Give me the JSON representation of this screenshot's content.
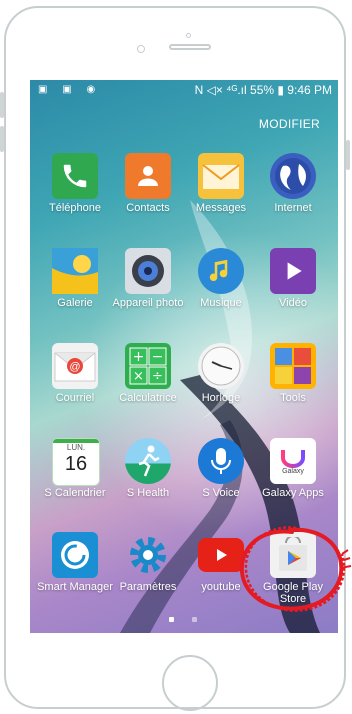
{
  "status_bar": {
    "left_icons": "▣ ▣ ◉",
    "right": "N ◁× ⁴ᴳ.ıl 55% ▮ 9:46 PM"
  },
  "top_action": "MODIFIER",
  "apps": [
    {
      "label": "Téléphone",
      "icon": "phone-icon",
      "color": "#2fa84f"
    },
    {
      "label": "Contacts",
      "icon": "contacts-icon",
      "color": "#f07a2c"
    },
    {
      "label": "Messages",
      "icon": "messages-icon",
      "color": "#f7c23b"
    },
    {
      "label": "Internet",
      "icon": "globe-icon",
      "color": "#3b5fc1"
    },
    {
      "label": "Galerie",
      "icon": "gallery-icon",
      "color": "#3aa0d8"
    },
    {
      "label": "Appareil photo",
      "icon": "camera-icon",
      "color": "#d9dde4"
    },
    {
      "label": "Musique",
      "icon": "music-icon",
      "color": "#2a8ad8"
    },
    {
      "label": "Vidéo",
      "icon": "video-icon",
      "color": "#7a3fb0"
    },
    {
      "label": "Courriel",
      "icon": "email-icon",
      "color": "#f2f2f2"
    },
    {
      "label": "Calculatrice",
      "icon": "calculator-icon",
      "color": "#2fae4f"
    },
    {
      "label": "Horloge",
      "icon": "clock-icon",
      "color": "#f3f3f3"
    },
    {
      "label": "Tools",
      "icon": "tools-folder-icon",
      "color": "#ffb300"
    },
    {
      "label": "S Calendrier",
      "icon": "calendar-icon",
      "color": "#ffffff",
      "day": "LUN.",
      "date": "16"
    },
    {
      "label": "S Health",
      "icon": "health-icon",
      "color": "#1fa66a"
    },
    {
      "label": "S Voice",
      "icon": "voice-icon",
      "color": "#1c7ad6"
    },
    {
      "label": "Galaxy Apps",
      "icon": "galaxy-apps-icon",
      "color": "#ffffff",
      "sub": "Galaxy"
    },
    {
      "label": "Smart Manager",
      "icon": "smart-manager-icon",
      "color": "#1b8fd4"
    },
    {
      "label": "Paramètres",
      "icon": "settings-icon",
      "color": "#1a89c9"
    },
    {
      "label": "youtube",
      "icon": "youtube-icon",
      "color": "#e62117"
    },
    {
      "label": "Google Play Store",
      "icon": "play-store-icon",
      "color": "#f1f1f1"
    }
  ],
  "pages": {
    "active": 1,
    "total": 2
  }
}
